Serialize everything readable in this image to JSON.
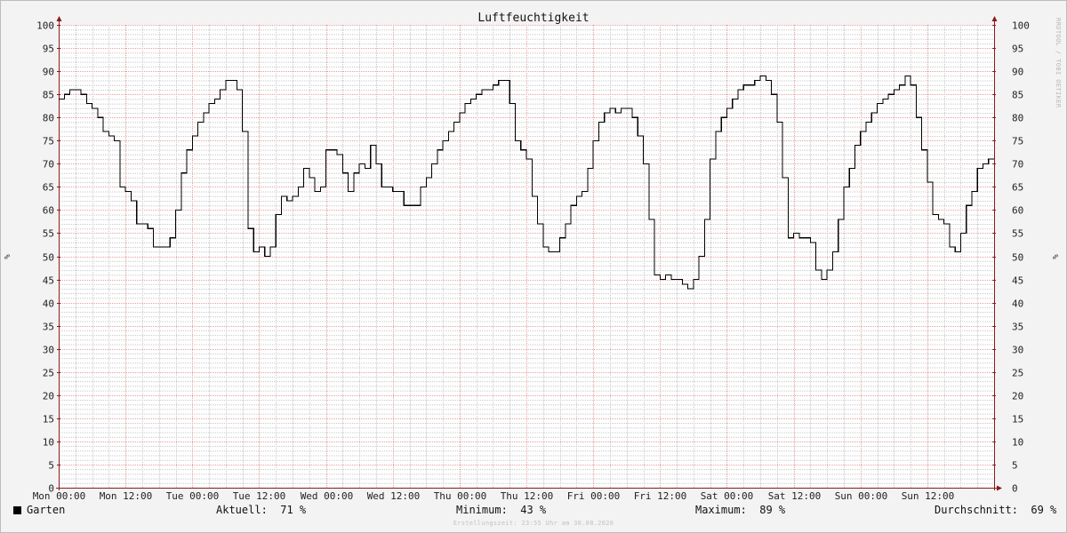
{
  "chart_data": {
    "type": "line",
    "title": "Luftfeuchtigkeit",
    "ylabel": "%",
    "ylabel_right": "%",
    "ylim": [
      0,
      100
    ],
    "ytick_step": 5,
    "grid": true,
    "x_range_hours": [
      0,
      168
    ],
    "xtick_labels": [
      "Mon 00:00",
      "Mon 12:00",
      "Tue 00:00",
      "Tue 12:00",
      "Wed 00:00",
      "Wed 12:00",
      "Thu 00:00",
      "Thu 12:00",
      "Fri 00:00",
      "Fri 12:00",
      "Sat 00:00",
      "Sat 12:00",
      "Sun 00:00",
      "Sun 12:00"
    ],
    "series": [
      {
        "name": "Garten",
        "color": "#000000",
        "step": true,
        "x_hours": [
          0,
          1,
          2,
          3,
          4,
          5,
          6,
          7,
          8,
          9,
          10,
          11,
          12,
          13,
          14,
          15,
          16,
          17,
          18,
          19,
          20,
          21,
          22,
          23,
          24,
          25,
          26,
          27,
          28,
          29,
          30,
          31,
          32,
          33,
          34,
          35,
          36,
          37,
          38,
          39,
          40,
          41,
          42,
          43,
          44,
          45,
          46,
          47,
          48,
          49,
          50,
          51,
          52,
          53,
          54,
          55,
          56,
          57,
          58,
          59,
          60,
          61,
          62,
          63,
          64,
          65,
          66,
          67,
          68,
          69,
          70,
          71,
          72,
          73,
          74,
          75,
          76,
          77,
          78,
          79,
          80,
          81,
          82,
          83,
          84,
          85,
          86,
          87,
          88,
          89,
          90,
          91,
          92,
          93,
          94,
          95,
          96,
          97,
          98,
          99,
          100,
          101,
          102,
          103,
          104,
          105,
          106,
          107,
          108,
          109,
          110,
          111,
          112,
          113,
          114,
          115,
          116,
          117,
          118,
          119,
          120,
          121,
          122,
          123,
          124,
          125,
          126,
          127,
          128,
          129,
          130,
          131,
          132,
          133,
          134,
          135,
          136,
          137,
          138,
          139,
          140,
          141,
          142,
          143,
          144,
          145,
          146,
          147,
          148,
          149,
          150,
          151,
          152,
          153,
          154,
          155,
          156,
          157,
          158,
          159,
          160,
          161,
          162,
          163,
          164,
          165,
          166,
          167
        ],
        "values": [
          84,
          85,
          86,
          86,
          85,
          83,
          82,
          80,
          77,
          76,
          75,
          65,
          64,
          62,
          57,
          57,
          56,
          52,
          52,
          52,
          54,
          60,
          68,
          73,
          76,
          79,
          81,
          83,
          84,
          86,
          88,
          88,
          86,
          77,
          56,
          51,
          52,
          50,
          52,
          59,
          63,
          62,
          63,
          65,
          69,
          67,
          64,
          65,
          73,
          73,
          72,
          68,
          64,
          68,
          70,
          69,
          74,
          70,
          65,
          65,
          64,
          64,
          61,
          61,
          61,
          65,
          67,
          70,
          73,
          75,
          77,
          79,
          81,
          83,
          84,
          85,
          86,
          86,
          87,
          88,
          88,
          83,
          75,
          73,
          71,
          63,
          57,
          52,
          51,
          51,
          54,
          57,
          61,
          63,
          64,
          69,
          75,
          79,
          81,
          82,
          81,
          82,
          82,
          80,
          76,
          70,
          58,
          46,
          45,
          46,
          45,
          45,
          44,
          43,
          45,
          50,
          58,
          71,
          77,
          80,
          82,
          84,
          86,
          87,
          87,
          88,
          89,
          88,
          85,
          79,
          67,
          54,
          55,
          54,
          54,
          53,
          47,
          45,
          47,
          51,
          58,
          65,
          69,
          74,
          77,
          79,
          81,
          83,
          84,
          85,
          86,
          87,
          89,
          87,
          80,
          73,
          66,
          59,
          58,
          57,
          52,
          51,
          55,
          61,
          64,
          69,
          70,
          71
        ]
      }
    ]
  },
  "legend": {
    "series_name": "Garten",
    "current_label": "Aktuell:",
    "current_value": "71 %",
    "min_label": "Minimum:",
    "min_value": "43 %",
    "max_label": "Maximum:",
    "max_value": "89 %",
    "avg_label": "Durchschnitt:",
    "avg_value": "69 %"
  },
  "footer_note": "Erstellungszeit: 23:55 Uhr am 30.08.2020",
  "watermark": "RRDTOOL / TOBI OETIKER",
  "colors": {
    "background": "#f3f3f3",
    "plot_background": "#ffffff",
    "minor_grid": "#c8c8c8",
    "major_grid": "#e8a0a0",
    "axis": "#8b1a1a",
    "line": "#000000"
  }
}
